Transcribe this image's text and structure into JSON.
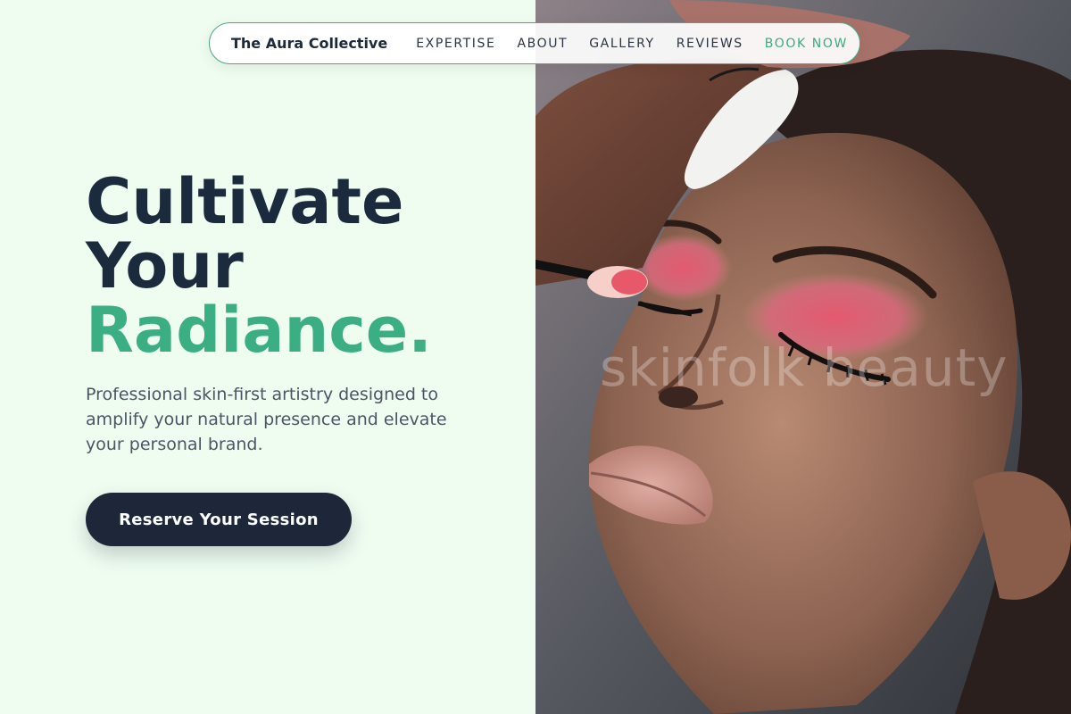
{
  "nav": {
    "brand": "The Aura Collective",
    "links": [
      {
        "label": "EXPERTISE"
      },
      {
        "label": "ABOUT"
      },
      {
        "label": "GALLERY"
      },
      {
        "label": "REVIEWS"
      },
      {
        "label": "BOOK NOW"
      }
    ]
  },
  "hero": {
    "headline_line1": "Cultivate",
    "headline_line2": "Your",
    "headline_accent": "Radiance.",
    "subtext": "Professional skin-first artistry designed to amplify your natural presence and elevate your personal brand.",
    "cta_label": "Reserve Your Session"
  },
  "image": {
    "watermark": "skinfolk beauty"
  },
  "colors": {
    "background": "#effdf1",
    "accent": "#3cae84",
    "dark": "#1d2739",
    "body_text": "#4b5664"
  }
}
